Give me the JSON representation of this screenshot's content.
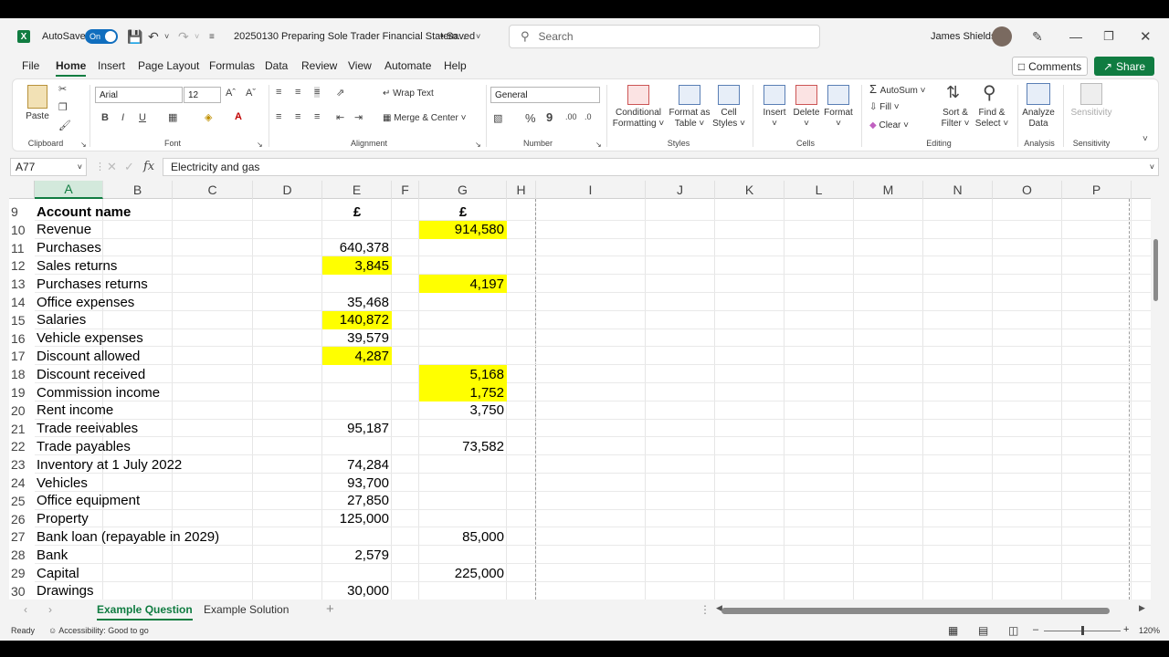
{
  "titlebar": {
    "app_icon": "excel-icon",
    "autosave_label": "AutoSave",
    "autosave_state": "On",
    "doc_title": "20250130 Preparing Sole Trader Financial Statem...",
    "saved_status": "• Saved",
    "search_placeholder": "Search",
    "user_name": "James Shields"
  },
  "tabs": [
    "File",
    "Home",
    "Insert",
    "Page Layout",
    "Formulas",
    "Data",
    "Review",
    "View",
    "Automate",
    "Help"
  ],
  "active_tab": "Home",
  "comments_label": "Comments",
  "share_label": "Share",
  "ribbon": {
    "clipboard": {
      "paste": "Paste",
      "label": "Clipboard"
    },
    "font": {
      "family": "Arial",
      "size": "12",
      "label": "Font",
      "bold": "B",
      "italic": "I",
      "underline": "U"
    },
    "alignment": {
      "wrap": "Wrap Text",
      "merge": "Merge & Center",
      "label": "Alignment"
    },
    "number": {
      "format": "General",
      "percent": "%",
      "comma": "9",
      "label": "Number"
    },
    "styles": {
      "conditional": "Conditional",
      "conditional2": "Formatting",
      "format_as": "Format as",
      "format_as2": "Table",
      "cell": "Cell",
      "cell2": "Styles",
      "label": "Styles"
    },
    "cells": {
      "insert": "Insert",
      "delete": "Delete",
      "format": "Format",
      "label": "Cells"
    },
    "editing": {
      "autosum": "AutoSum",
      "fill": "Fill",
      "clear": "Clear",
      "sort": "Sort &",
      "sort2": "Filter",
      "find": "Find &",
      "find2": "Select",
      "label": "Editing"
    },
    "analysis": {
      "analyze": "Analyze",
      "analyze2": "Data",
      "label": "Analysis"
    },
    "sensitivity": {
      "name": "Sensitivity",
      "label": "Sensitivity"
    }
  },
  "formula_bar": {
    "name_box": "A77",
    "fx": "fx",
    "content": "Electricity and gas"
  },
  "columns": [
    "A",
    "B",
    "C",
    "D",
    "E",
    "F",
    "G",
    "H",
    "I",
    "J",
    "K",
    "L",
    "M",
    "N",
    "O",
    "P"
  ],
  "selected_column": "A",
  "rows": [
    {
      "n": "9",
      "a": "Account name",
      "e": "£",
      "g": "£",
      "bold": true
    },
    {
      "n": "10",
      "a": "Revenue",
      "e": "",
      "g": "914,580",
      "ghl": true
    },
    {
      "n": "11",
      "a": "Purchases",
      "e": "640,378",
      "g": ""
    },
    {
      "n": "12",
      "a": "Sales returns",
      "e": "3,845",
      "g": "",
      "ehl": true
    },
    {
      "n": "13",
      "a": "Purchases returns",
      "e": "",
      "g": "4,197",
      "ghl": true
    },
    {
      "n": "14",
      "a": "Office expenses",
      "e": "35,468",
      "g": ""
    },
    {
      "n": "15",
      "a": "Salaries",
      "e": "140,872",
      "g": "",
      "ehl": true
    },
    {
      "n": "16",
      "a": "Vehicle expenses",
      "e": "39,579",
      "g": ""
    },
    {
      "n": "17",
      "a": "Discount allowed",
      "e": "4,287",
      "g": "",
      "ehl": true
    },
    {
      "n": "18",
      "a": "Discount received",
      "e": "",
      "g": "5,168",
      "ghl": true
    },
    {
      "n": "19",
      "a": "Commission income",
      "e": "",
      "g": "1,752",
      "ghl": true
    },
    {
      "n": "20",
      "a": "Rent income",
      "e": "",
      "g": "3,750"
    },
    {
      "n": "21",
      "a": "Trade reeivables",
      "e": "95,187",
      "g": ""
    },
    {
      "n": "22",
      "a": "Trade payables",
      "e": "",
      "g": "73,582"
    },
    {
      "n": "23",
      "a": "Inventory at 1 July 2022",
      "e": "74,284",
      "g": ""
    },
    {
      "n": "24",
      "a": "Vehicles",
      "e": "93,700",
      "g": ""
    },
    {
      "n": "25",
      "a": "Office equipment",
      "e": "27,850",
      "g": ""
    },
    {
      "n": "26",
      "a": "Property",
      "e": "125,000",
      "g": ""
    },
    {
      "n": "27",
      "a": "Bank loan (repayable in 2029)",
      "e": "",
      "g": "85,000"
    },
    {
      "n": "28",
      "a": "Bank",
      "e": "2,579",
      "g": ""
    },
    {
      "n": "29",
      "a": "Capital",
      "e": "",
      "g": "225,000"
    },
    {
      "n": "30",
      "a": "Drawings",
      "e": "30,000",
      "g": ""
    }
  ],
  "sheets": [
    "Example Question",
    "Example Solution"
  ],
  "active_sheet": "Example Question",
  "status": {
    "ready": "Ready",
    "accessibility": "Accessibility: Good to go",
    "zoom": "120%"
  },
  "colors": {
    "accent": "#107c41",
    "highlight": "#ffff00"
  }
}
